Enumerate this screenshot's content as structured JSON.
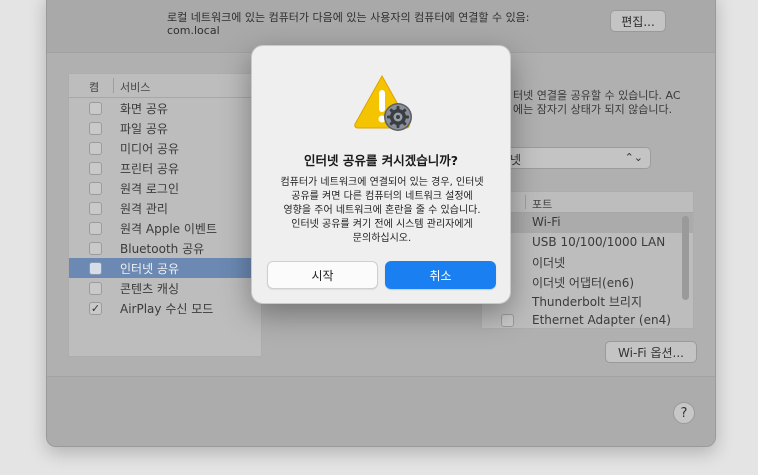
{
  "top": {
    "line1": "로컬 네트워크에 있는 컴퓨터가 다음에 있는 사용자의 컴퓨터에 연결할 수 있음:",
    "line2": "com.local",
    "edit_label": "편집..."
  },
  "services": {
    "header_on": "켬",
    "header_service": "서비스",
    "items": [
      {
        "label": "화면 공유",
        "checked": false,
        "selected": false
      },
      {
        "label": "파일 공유",
        "checked": false,
        "selected": false
      },
      {
        "label": "미디어 공유",
        "checked": false,
        "selected": false
      },
      {
        "label": "프린터 공유",
        "checked": false,
        "selected": false
      },
      {
        "label": "원격 로그인",
        "checked": false,
        "selected": false
      },
      {
        "label": "원격 관리",
        "checked": false,
        "selected": false
      },
      {
        "label": "원격 Apple 이벤트",
        "checked": false,
        "selected": false
      },
      {
        "label": "Bluetooth 공유",
        "checked": false,
        "selected": false
      },
      {
        "label": "인터넷 공유",
        "checked": false,
        "selected": true
      },
      {
        "label": "콘텐츠 캐싱",
        "checked": false,
        "selected": false
      },
      {
        "label": "AirPlay 수신 모드",
        "checked": true,
        "selected": false
      }
    ]
  },
  "right": {
    "desc_line1": "터넷 연결을 공유할 수 있습니다. AC",
    "desc_line2": "에는 잠자기 상태가 되지 않습니다.",
    "share_from_value": "넷",
    "ports_header": "포트",
    "ports": [
      "Wi-Fi",
      "USB 10/100/1000 LAN",
      "이더넷",
      "이더넷 어댑터(en6)",
      "Thunderbolt 브리지",
      "Ethernet Adapter (en4)"
    ],
    "wifi_options_label": "Wi-Fi 옵션...",
    "help_label": "?"
  },
  "dialog": {
    "icon": "warning-gear-icon",
    "title": "인터넷 공유를 켜시겠습니까?",
    "message_lines": [
      "컴퓨터가 네트워크에 연결되어 있는 경우, 인터넷",
      "공유를 켜면 다른 컴퓨터의 네트워크 설정에",
      "영향을 주어 네트워크에 혼란을 줄 수 있습니다.",
      "인터넷 공유를 켜기 전에 시스템 관리자에게",
      "문의하십시오."
    ],
    "start_label": "시작",
    "cancel_label": "취소"
  },
  "colors": {
    "accent": "#1a80f2",
    "selection": "#6b89b3",
    "warning": "#f5c400"
  }
}
